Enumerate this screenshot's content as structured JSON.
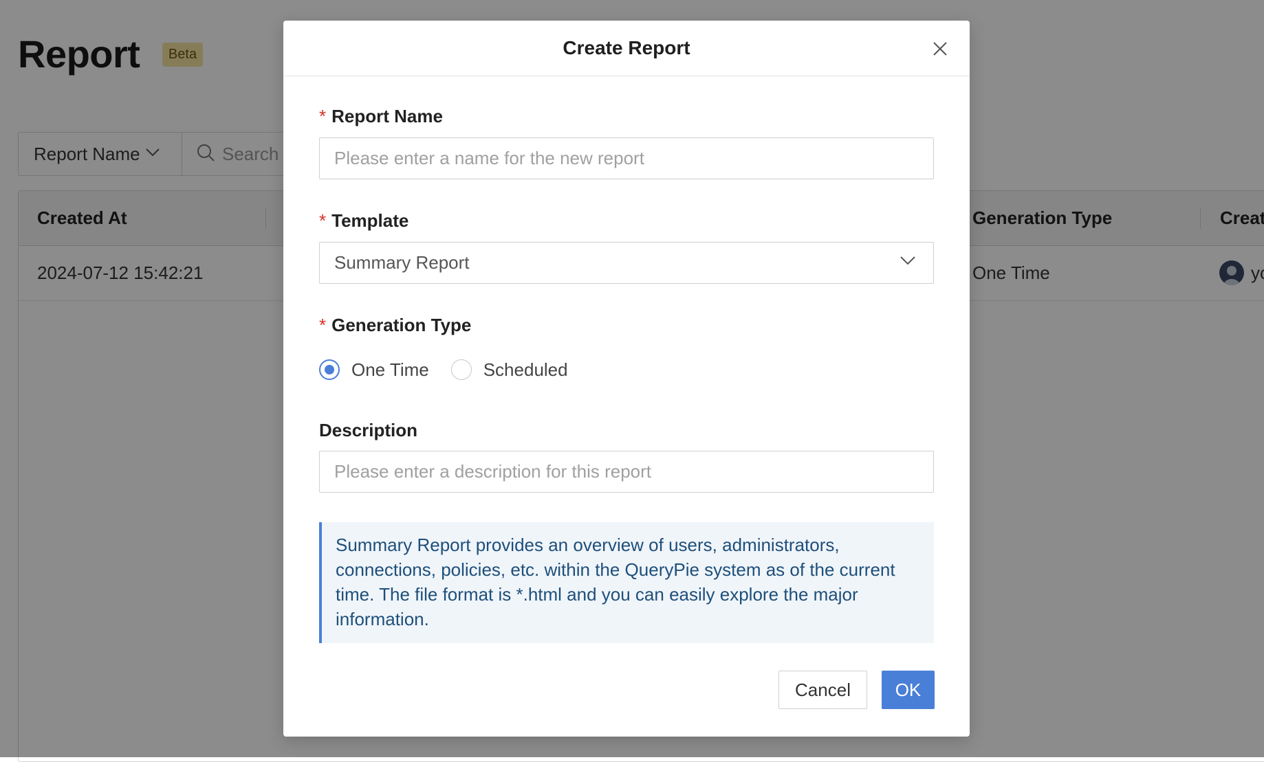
{
  "page": {
    "title": "Report",
    "badge": "Beta",
    "filter": {
      "field_label": "Report Name",
      "search_placeholder": "Search"
    },
    "table": {
      "columns": [
        "Created At",
        "Generation Type",
        "Creat"
      ],
      "rows": [
        {
          "created_at": "2024-07-12 15:42:21",
          "generation_type": "One Time",
          "creator": "yo"
        }
      ]
    }
  },
  "modal": {
    "title": "Create Report",
    "report_name": {
      "label": "Report Name",
      "placeholder": "Please enter a name for the new report",
      "value": ""
    },
    "template": {
      "label": "Template",
      "selected": "Summary Report"
    },
    "generation_type": {
      "label": "Generation Type",
      "options": [
        "One Time",
        "Scheduled"
      ],
      "selected": "One Time"
    },
    "description": {
      "label": "Description",
      "placeholder": "Please enter a description for this report",
      "value": ""
    },
    "info_text": "Summary Report provides an overview of users, administrators, connections, policies, etc. within the QueryPie system as of the current time. The file format is *.html and you can easily explore the major information.",
    "buttons": {
      "cancel": "Cancel",
      "ok": "OK"
    }
  },
  "colors": {
    "primary": "#4a7fd8",
    "required": "#d93025",
    "info_bg": "#f0f5fa",
    "info_text": "#1e4f7a",
    "badge_bg": "#f4e3a1"
  },
  "icons": {
    "close": "close-icon",
    "chevron": "chevron-down-icon",
    "search": "search-icon",
    "avatar": "avatar"
  }
}
